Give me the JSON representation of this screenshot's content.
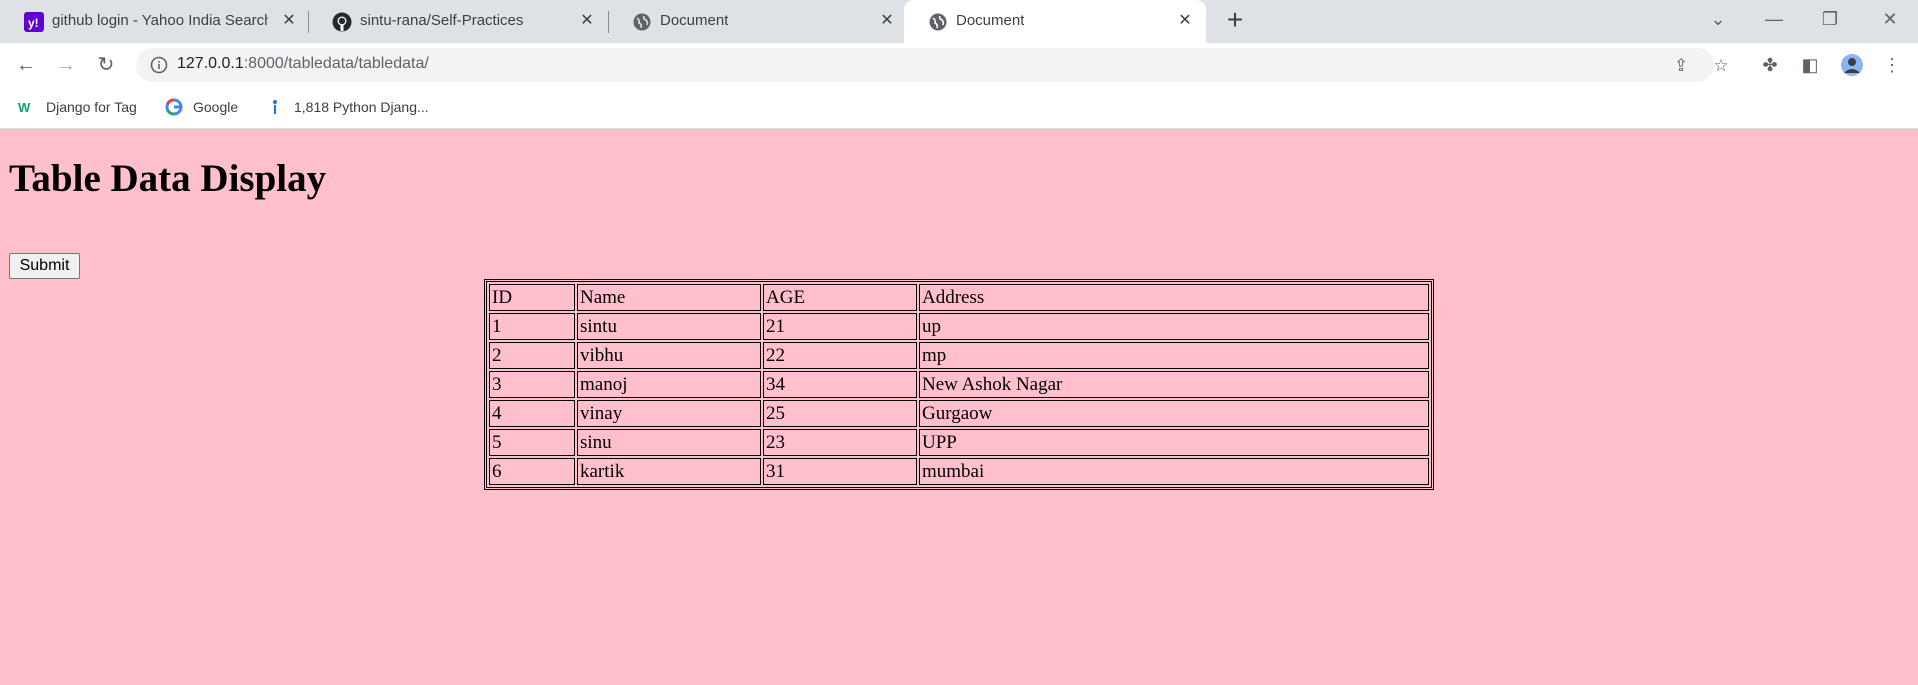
{
  "browser": {
    "tabs": [
      {
        "title": "github login - Yahoo India Search",
        "favicon": "yahoo-icon",
        "active": false
      },
      {
        "title": "sintu-rana/Self-Practices",
        "favicon": "github-icon",
        "active": false
      },
      {
        "title": "Document",
        "favicon": "globe-icon",
        "active": false
      },
      {
        "title": "Document",
        "favicon": "globe-icon",
        "active": true
      }
    ],
    "new_tab_label": "+",
    "url_host": "127.0.0.1",
    "url_path": ":8000/tabledata/tabledata/",
    "bookmarks": [
      {
        "label": "Django for Tag",
        "icon": "w3-icon"
      },
      {
        "label": "Google",
        "icon": "google-icon"
      },
      {
        "label": "1,818 Python Djang...",
        "icon": "bookmark-site-icon"
      }
    ]
  },
  "page": {
    "heading": "Table Data Display",
    "submit_label": "Submit",
    "background_color": "#ffc0cb",
    "table": {
      "headers": [
        "ID",
        "Name",
        "AGE",
        "Address"
      ],
      "rows": [
        [
          "1",
          "sintu",
          "21",
          "up"
        ],
        [
          "2",
          "vibhu",
          "22",
          "mp"
        ],
        [
          "3",
          "manoj",
          "34",
          "New Ashok Nagar"
        ],
        [
          "4",
          "vinay",
          "25",
          "Gurgaow"
        ],
        [
          "5",
          "sinu",
          "23",
          "UPP"
        ],
        [
          "6",
          "kartik",
          "31",
          "mumbai"
        ]
      ]
    }
  }
}
